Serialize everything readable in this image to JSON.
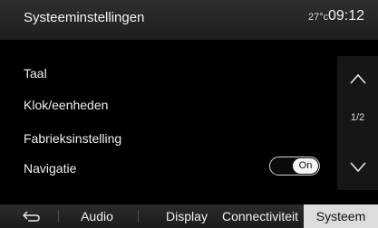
{
  "header": {
    "title": "Systeeminstellingen",
    "temperature": "27°c",
    "time": "09:12"
  },
  "settings": {
    "items": [
      {
        "label": "Taal"
      },
      {
        "label": "Klok/eenheden"
      },
      {
        "label": "Fabrieksinstelling"
      },
      {
        "label": "Navigatie",
        "toggle": "On"
      }
    ]
  },
  "scroll": {
    "page": "1/2",
    "up_icon": "chevron-up-icon",
    "down_icon": "chevron-down-icon"
  },
  "tabs": {
    "back_icon": "back-arrow-icon",
    "items": [
      {
        "label": "Audio"
      },
      {
        "label": "Display"
      },
      {
        "label": "Connectiviteit"
      },
      {
        "label": "Systeem",
        "active": true
      }
    ]
  },
  "colors": {
    "active_tab_bg": "#dcdcdc",
    "toggle_knob": "#f4f4f4"
  }
}
